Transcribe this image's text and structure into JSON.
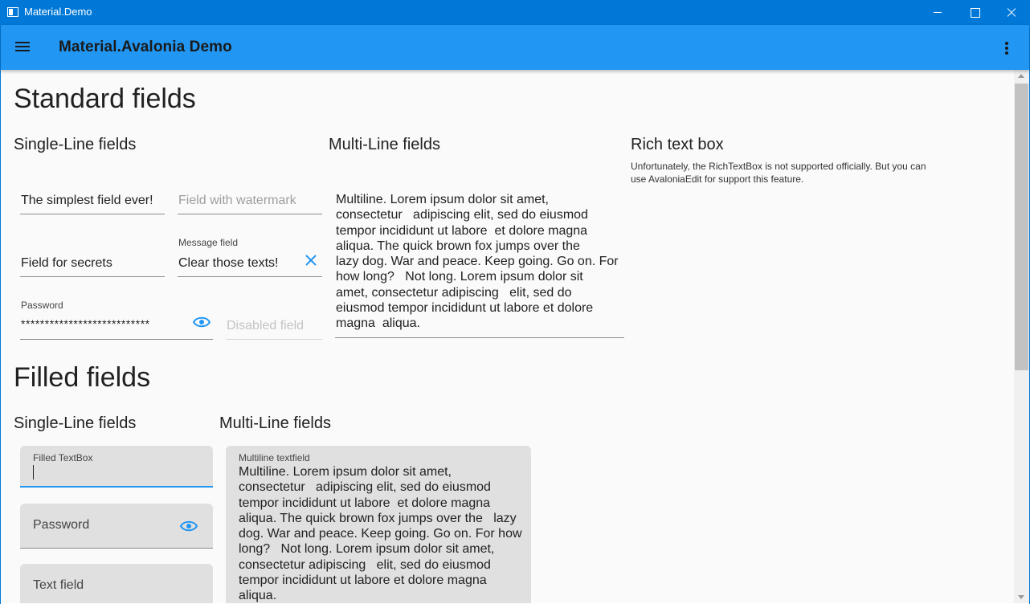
{
  "window": {
    "title": "Material.Demo"
  },
  "appbar": {
    "title": "Material.Avalonia Demo"
  },
  "standard": {
    "heading": "Standard fields",
    "single_line_heading": "Single-Line fields",
    "multi_line_heading": "Multi-Line fields",
    "rich_heading": "Rich text box",
    "rich_note": "Unfortunately, the RichTextBox is not supported officially. But you can use AvaloniaEdit for support this feature.",
    "simplest_field": "The simplest field ever!",
    "watermark_placeholder": "Field with watermark",
    "secrets_field": "Field for secrets",
    "message_hint": "Message field",
    "message_value": "Clear those texts!",
    "password_hint": "Password",
    "password_value": "***************************",
    "disabled_placeholder": "Disabled field",
    "multiline_lines": [
      "Multiline. Lorem ipsum dolor sit amet,",
      "consectetur   adipiscing elit, sed do eiusmod",
      "tempor incididunt ut labore  et dolore magna",
      "aliqua. The quick brown fox jumps over the",
      "lazy dog. War and peace. Keep going. Go on. For",
      "how long?   Not long. Lorem ipsum dolor sit",
      "amet, consectetur adipiscing   elit, sed do",
      "eiusmod tempor incididunt ut labore et dolore",
      "magna  aliqua."
    ]
  },
  "filled": {
    "heading": "Filled fields",
    "single_line_heading": "Single-Line fields",
    "multi_line_heading": "Multi-Line fields",
    "textbox_hint": "Filled TextBox",
    "password_placeholder": "Password",
    "text_field_placeholder": "Text field",
    "multiline_hint": "Multiline textfield",
    "multiline_lines": [
      "Multiline. Lorem ipsum dolor sit amet,",
      "consectetur   adipiscing elit, sed do eiusmod",
      "tempor incididunt ut labore  et dolore magna",
      "aliqua. The quick brown fox jumps over the   lazy",
      "dog. War and peace. Keep going. Go on. For how",
      "long?   Not long. Lorem ipsum dolor sit amet,",
      "consectetur adipiscing   elit, sed do eiusmod",
      "tempor incididunt ut labore et dolore magna",
      "aliqua."
    ]
  },
  "colors": {
    "titlebar": "#0078d7",
    "appbar": "#2196f3",
    "accent": "#2196f3",
    "filled_bg": "#e0e0e0"
  },
  "icons": {
    "menu": "hamburger-icon",
    "more": "kebab-icon",
    "clear": "close-icon",
    "reveal": "eye-icon"
  }
}
